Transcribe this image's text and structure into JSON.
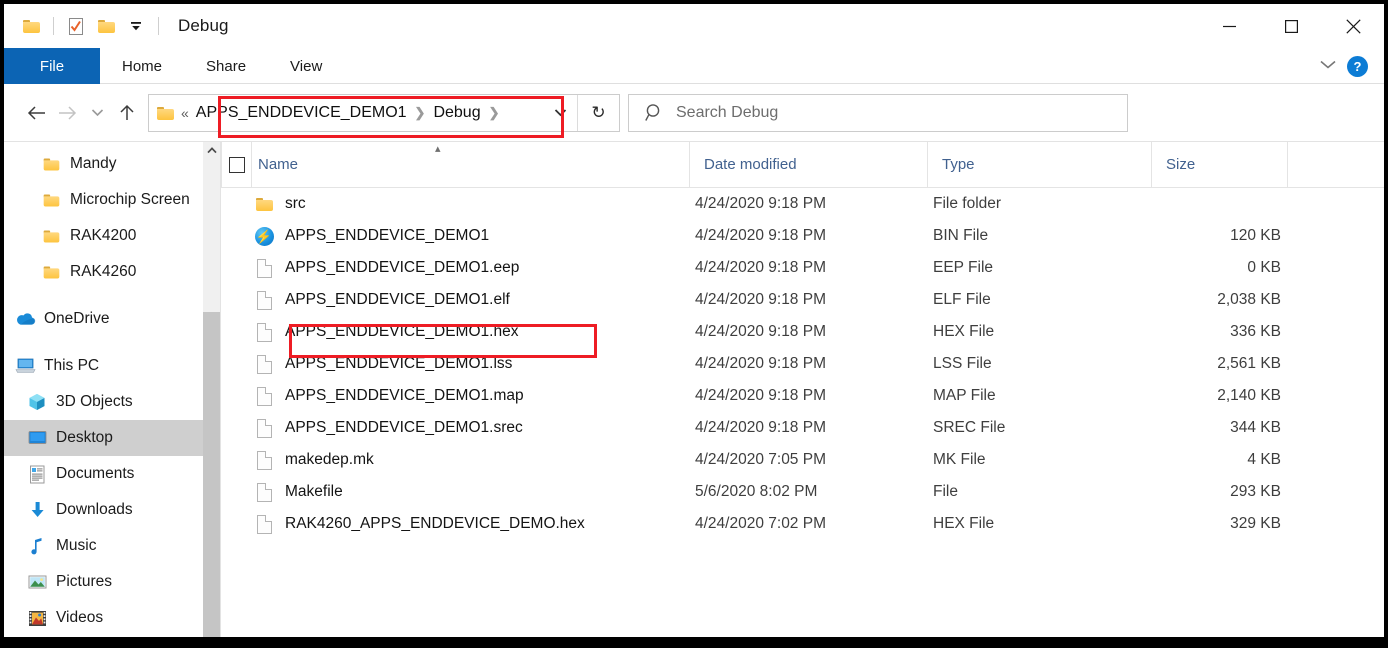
{
  "window": {
    "title": "Debug",
    "quick_access": [
      "folder-icon",
      "properties-icon",
      "new-folder-icon",
      "customize-dropdown-icon"
    ],
    "controls": {
      "minimize": "—",
      "maximize": "□",
      "close": "✕"
    }
  },
  "ribbon": {
    "tabs": [
      {
        "label": "File",
        "active": true
      },
      {
        "label": "Home",
        "active": false
      },
      {
        "label": "Share",
        "active": false
      },
      {
        "label": "View",
        "active": false
      }
    ],
    "expand_label": "⌄",
    "help_label": "?"
  },
  "addressbar": {
    "back_label": "←",
    "forward_label": "→",
    "recent_label": "⌄",
    "up_label": "↑",
    "overflow_label": "«",
    "crumbs": [
      "APPS_ENDDEVICE_DEMO1",
      "Debug"
    ],
    "crumb_sep": "❯",
    "dropdown_label": "⌄",
    "refresh_label": "↻"
  },
  "search": {
    "placeholder": "Search Debug",
    "icon": "search-icon"
  },
  "sidebar": {
    "items": [
      {
        "label": "Mandy",
        "icon": "folder-icon",
        "indent": 3,
        "selected": false
      },
      {
        "label": "Microchip Screen",
        "icon": "folder-icon",
        "indent": 3,
        "selected": false
      },
      {
        "label": "RAK4200",
        "icon": "folder-icon",
        "indent": 3,
        "selected": false
      },
      {
        "label": "RAK4260",
        "icon": "folder-icon",
        "indent": 3,
        "selected": false
      },
      {
        "gap": true
      },
      {
        "label": "OneDrive",
        "icon": "onedrive-icon",
        "indent": 1,
        "selected": false
      },
      {
        "gap": true
      },
      {
        "label": "This PC",
        "icon": "this-pc-icon",
        "indent": 1,
        "selected": false
      },
      {
        "label": "3D Objects",
        "icon": "3d-objects-icon",
        "indent": 2,
        "selected": false
      },
      {
        "label": "Desktop",
        "icon": "desktop-icon",
        "indent": 2,
        "selected": true
      },
      {
        "label": "Documents",
        "icon": "documents-icon",
        "indent": 2,
        "selected": false
      },
      {
        "label": "Downloads",
        "icon": "downloads-icon",
        "indent": 2,
        "selected": false
      },
      {
        "label": "Music",
        "icon": "music-icon",
        "indent": 2,
        "selected": false
      },
      {
        "label": "Pictures",
        "icon": "pictures-icon",
        "indent": 2,
        "selected": false
      },
      {
        "label": "Videos",
        "icon": "videos-icon",
        "indent": 2,
        "selected": false
      }
    ]
  },
  "columns": {
    "name": "Name",
    "date_modified": "Date modified",
    "type": "Type",
    "size": "Size",
    "sort_indicator": "▴"
  },
  "files": [
    {
      "name": "src",
      "icon": "folder-icon",
      "date": "4/24/2020 9:18 PM",
      "type": "File folder",
      "size": ""
    },
    {
      "name": "APPS_ENDDEVICE_DEMO1",
      "icon": "bin-icon",
      "date": "4/24/2020 9:18 PM",
      "type": "BIN File",
      "size": "120 KB"
    },
    {
      "name": "APPS_ENDDEVICE_DEMO1.eep",
      "icon": "file-icon",
      "date": "4/24/2020 9:18 PM",
      "type": "EEP File",
      "size": "0 KB"
    },
    {
      "name": "APPS_ENDDEVICE_DEMO1.elf",
      "icon": "file-icon",
      "date": "4/24/2020 9:18 PM",
      "type": "ELF File",
      "size": "2,038 KB"
    },
    {
      "name": "APPS_ENDDEVICE_DEMO1.hex",
      "icon": "file-icon",
      "date": "4/24/2020 9:18 PM",
      "type": "HEX File",
      "size": "336 KB",
      "highlighted": true
    },
    {
      "name": "APPS_ENDDEVICE_DEMO1.lss",
      "icon": "file-icon",
      "date": "4/24/2020 9:18 PM",
      "type": "LSS File",
      "size": "2,561 KB"
    },
    {
      "name": "APPS_ENDDEVICE_DEMO1.map",
      "icon": "file-icon",
      "date": "4/24/2020 9:18 PM",
      "type": "MAP File",
      "size": "2,140 KB"
    },
    {
      "name": "APPS_ENDDEVICE_DEMO1.srec",
      "icon": "file-icon",
      "date": "4/24/2020 9:18 PM",
      "type": "SREC File",
      "size": "344 KB"
    },
    {
      "name": "makedep.mk",
      "icon": "file-icon",
      "date": "4/24/2020 7:05 PM",
      "type": "MK File",
      "size": "4 KB"
    },
    {
      "name": "Makefile",
      "icon": "file-icon",
      "date": "5/6/2020 8:02 PM",
      "type": "File",
      "size": "293 KB"
    },
    {
      "name": "RAK4260_APPS_ENDDEVICE_DEMO.hex",
      "icon": "file-icon",
      "date": "4/24/2020 7:02 PM",
      "type": "HEX File",
      "size": "329 KB"
    }
  ],
  "annotations": {
    "color": "#ee1c24",
    "boxes": [
      "address-bar-path",
      "file-row-hex"
    ]
  }
}
